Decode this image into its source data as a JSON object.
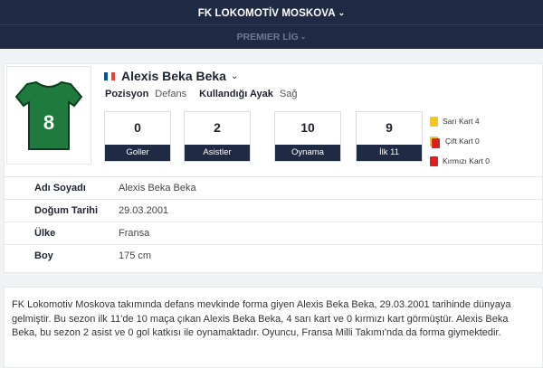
{
  "header": {
    "team": "FK LOKOMOTİV MOSKOVA",
    "team_chevron": "⌄",
    "league": "PREMIER LİG",
    "league_chevron": "⌄"
  },
  "player": {
    "name": "Alexis Beka Beka",
    "name_chevron": "⌄",
    "shirt_number": "8",
    "flag_colors": [
      "#0055A4",
      "#FFFFFF",
      "#EF4135"
    ],
    "position_label": "Pozisyon",
    "position_value": "Defans",
    "foot_label": "Kullandığı Ayak",
    "foot_value": "Sağ"
  },
  "stats": [
    {
      "value": "0",
      "label": "Goller"
    },
    {
      "value": "2",
      "label": "Asistler"
    },
    {
      "value": "10",
      "label": "Oynama"
    },
    {
      "value": "9",
      "label": "İlk 11"
    }
  ],
  "cards": {
    "yellow": "Sarı Kart 4",
    "double": "Çift Kart 0",
    "red": "Kırmızı Kart 0"
  },
  "info": [
    {
      "key": "Adı Soyadı",
      "value": "Alexis Beka Beka"
    },
    {
      "key": "Doğum Tarihi",
      "value": "29.03.2001"
    },
    {
      "key": "Ülke",
      "value": "Fransa"
    },
    {
      "key": "Boy",
      "value": "175 cm"
    }
  ],
  "description": "FK Lokomotiv Moskova takımında defans mevkinde forma giyen Alexis Beka Beka, 29.03.2001 tarihinde dünyaya gelmiştir. Bu sezon ilk 11'de 10 maça çıkan Alexis Beka Beka, 4 sarı kart ve 0 kırmızı kart görmüştür. Alexis Beka Beka, bu sezon 2 asist ve 0 gol katkısı ile oynamaktadır. Oyuncu, Fransa Milli Takımı'nda da forma giymektedir.",
  "colors": {
    "navy": "#1f2a44",
    "jersey": "#1f7a3d",
    "yellow_card": "#f5c518",
    "red_card": "#e01e1e"
  }
}
